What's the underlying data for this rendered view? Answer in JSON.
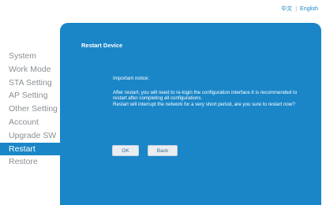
{
  "lang": {
    "chinese": "中文",
    "separator": "|",
    "english": "English"
  },
  "sidebar": {
    "items": [
      {
        "label": "System"
      },
      {
        "label": "Work Mode"
      },
      {
        "label": "STA Setting"
      },
      {
        "label": "AP Setting"
      },
      {
        "label": "Other Setting"
      },
      {
        "label": "Account"
      },
      {
        "label": "Upgrade SW"
      },
      {
        "label": "Restart"
      },
      {
        "label": "Restore"
      }
    ],
    "active": "Restart"
  },
  "panel": {
    "title": "Restart Device",
    "notice_heading": "Important notice:",
    "notice_line1": "After restart, you will need to re-login the configuration interface.It is recommended to restart after completing all configurations.",
    "notice_line2": "Restart will interrupt the network for a very short period, are you sure to restart now?",
    "ok_label": "OK",
    "back_label": "Back"
  },
  "colors": {
    "accent": "#1a86c8",
    "text_muted": "#8a8f94",
    "button_bg": "#e8edf1"
  }
}
